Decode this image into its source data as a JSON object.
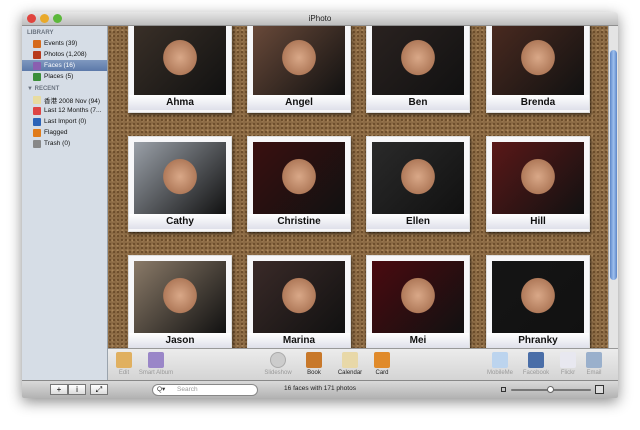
{
  "window": {
    "title": "iPhoto"
  },
  "sidebar": {
    "library_header": "LIBRARY",
    "library": [
      {
        "label": "Events (39)",
        "color": "#d66a1c"
      },
      {
        "label": "Photos (1,208)",
        "color": "#b83a1c"
      },
      {
        "label": "Faces (16)",
        "color": "#8a5fb0",
        "selected": true
      },
      {
        "label": "Places (5)",
        "color": "#3b8f3a"
      }
    ],
    "recent_header": "▼ RECENT",
    "recent": [
      {
        "label": "香港 2008 Nov (94)",
        "color": "#e8dca0"
      },
      {
        "label": "Last 12 Months (7...",
        "color": "#d44"
      },
      {
        "label": "Last Import (0)",
        "color": "#2b63b8"
      },
      {
        "label": "Flagged",
        "color": "#e07b1a"
      },
      {
        "label": "Trash (0)",
        "color": "#888"
      }
    ]
  },
  "faces": [
    {
      "name": "Ahma",
      "tone": "#3a3028"
    },
    {
      "name": "Angel",
      "tone": "#6a4a3a"
    },
    {
      "name": "Ben",
      "tone": "#2a2220"
    },
    {
      "name": "Brenda",
      "tone": "#4a2a20"
    },
    {
      "name": "Cathy",
      "tone": "#9aa0a8"
    },
    {
      "name": "Christine",
      "tone": "#3a1010"
    },
    {
      "name": "Ellen",
      "tone": "#2a2a2a"
    },
    {
      "name": "Hill",
      "tone": "#5a1818"
    },
    {
      "name": "Jason",
      "tone": "#8a7a68"
    },
    {
      "name": "Marina",
      "tone": "#3a2a28"
    },
    {
      "name": "Mei",
      "tone": "#4a0a10"
    },
    {
      "name": "Phranky",
      "tone": "#151515"
    }
  ],
  "toolbar": {
    "left": [
      {
        "label": "Edit",
        "color": "#e0b060"
      },
      {
        "label": "Smart Album",
        "color": "#9a86c8"
      }
    ],
    "center": [
      {
        "label": "Slideshow",
        "color": "#ccc",
        "enabled": false
      },
      {
        "label": "Book",
        "color": "#c8782a",
        "enabled": true
      },
      {
        "label": "Calendar",
        "color": "#e8d8a8",
        "enabled": true
      },
      {
        "label": "Card",
        "color": "#e08a2a",
        "enabled": true
      }
    ],
    "right": [
      {
        "label": "MobileMe",
        "color": "#bcd4ee"
      },
      {
        "label": "Facebook",
        "color": "#4a6ea8"
      },
      {
        "label": "Flickr",
        "color": "#e8e8f0"
      },
      {
        "label": "Email",
        "color": "#9ab0cc"
      }
    ]
  },
  "bottom": {
    "add": "+",
    "info": "i",
    "fullscreen": "⤢",
    "search_placeholder": "Search",
    "search_menu": "Q▾",
    "status": "16 faces with 171 photos"
  }
}
